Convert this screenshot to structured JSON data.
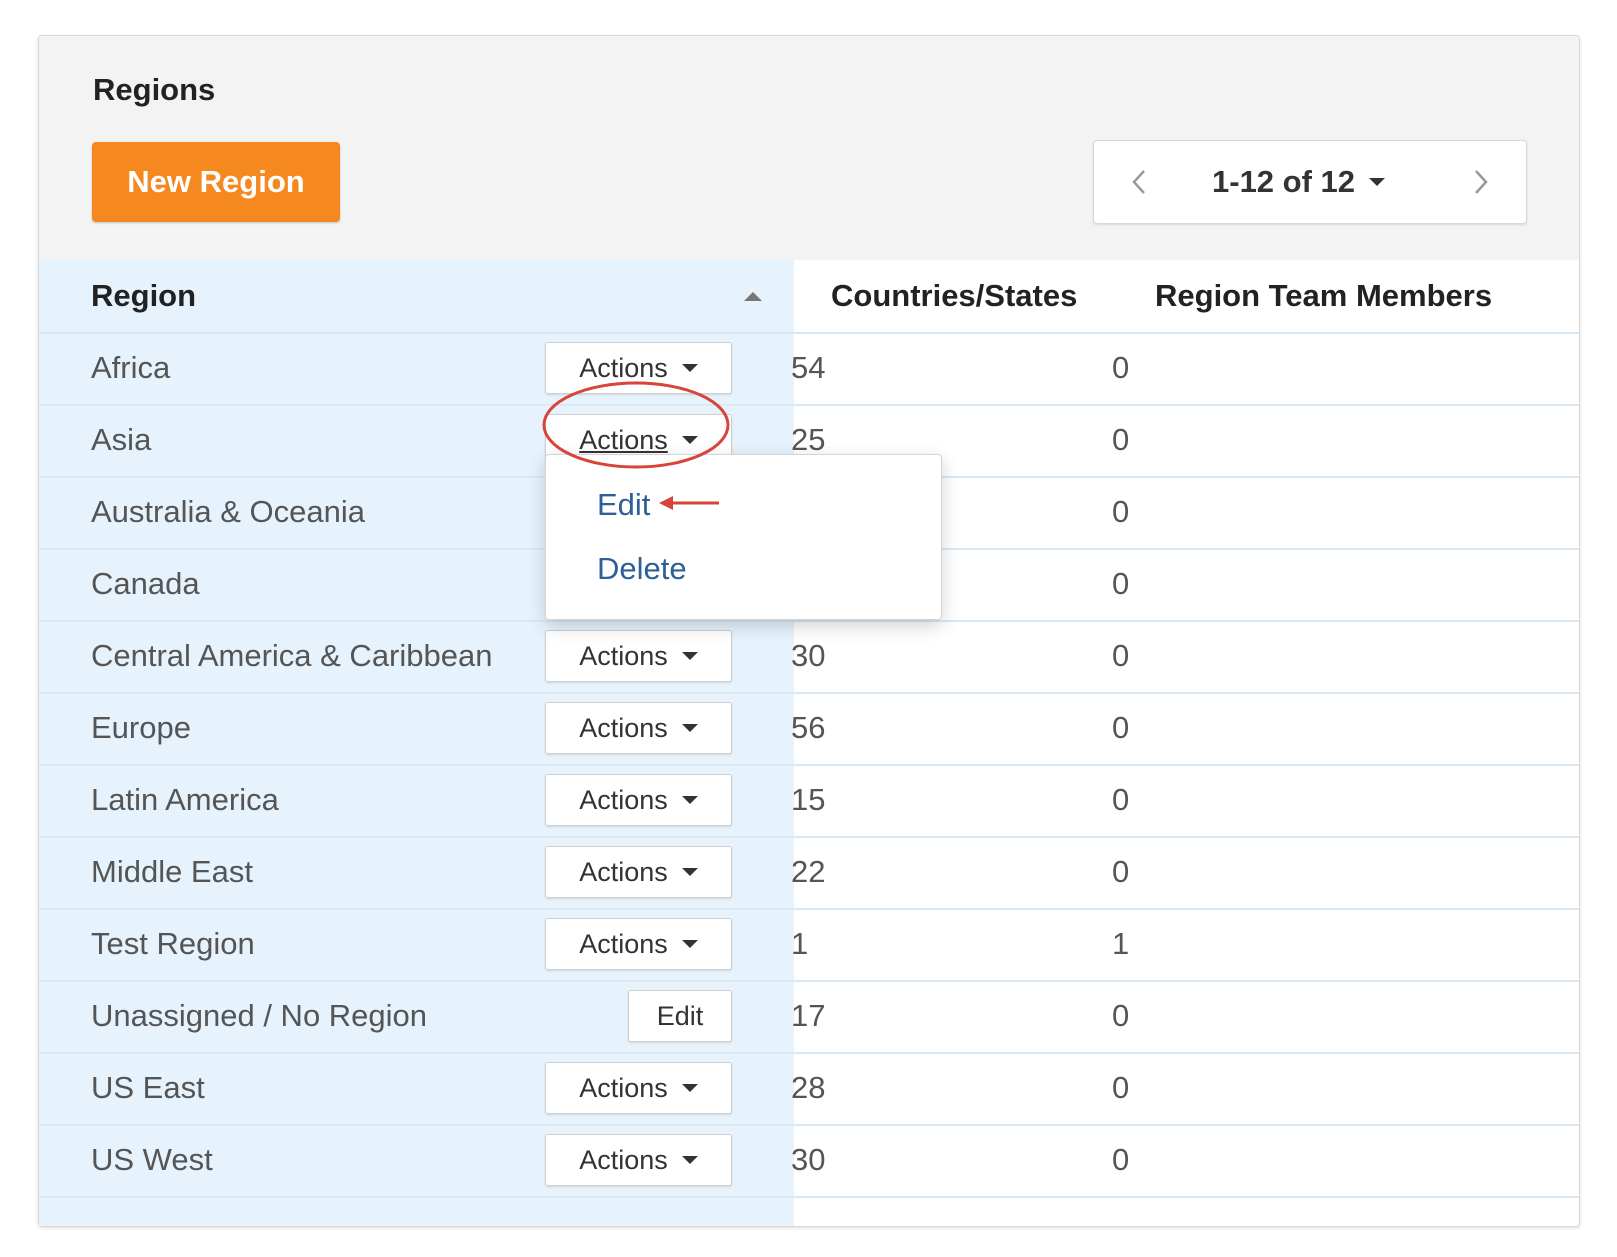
{
  "panel": {
    "title": "Regions",
    "new_button": "New Region"
  },
  "pager": {
    "range": "1-12 of 12"
  },
  "table": {
    "headers": {
      "region": "Region",
      "countries": "Countries/States",
      "members": "Region Team Members"
    },
    "rows": [
      {
        "region": "Africa",
        "action": "Actions",
        "countries": "54",
        "members": "0"
      },
      {
        "region": "Asia",
        "action": "Actions",
        "countries": "25",
        "members": "0"
      },
      {
        "region": "Australia & Oceania",
        "action": "",
        "countries": "",
        "members": "0"
      },
      {
        "region": "Canada",
        "action": "",
        "countries": "",
        "members": "0"
      },
      {
        "region": "Central America & Caribbean",
        "action": "Actions",
        "countries": "30",
        "members": "0"
      },
      {
        "region": "Europe",
        "action": "Actions",
        "countries": "56",
        "members": "0"
      },
      {
        "region": "Latin America",
        "action": "Actions",
        "countries": "15",
        "members": "0"
      },
      {
        "region": "Middle East",
        "action": "Actions",
        "countries": "22",
        "members": "0"
      },
      {
        "region": "Test Region",
        "action": "Actions",
        "countries": "1",
        "members": "1"
      },
      {
        "region": "Unassigned / No Region",
        "action": "Edit",
        "countries": "17",
        "members": "0"
      },
      {
        "region": "US East",
        "action": "Actions",
        "countries": "28",
        "members": "0"
      },
      {
        "region": "US West",
        "action": "Actions",
        "countries": "30",
        "members": "0"
      }
    ]
  },
  "dropdown": {
    "edit": "Edit",
    "delete": "Delete"
  },
  "colors": {
    "accent": "#f5891f",
    "region_column_bg": "#e6f3fd",
    "link": "#2e5f96",
    "annotation": "#d9443a"
  }
}
